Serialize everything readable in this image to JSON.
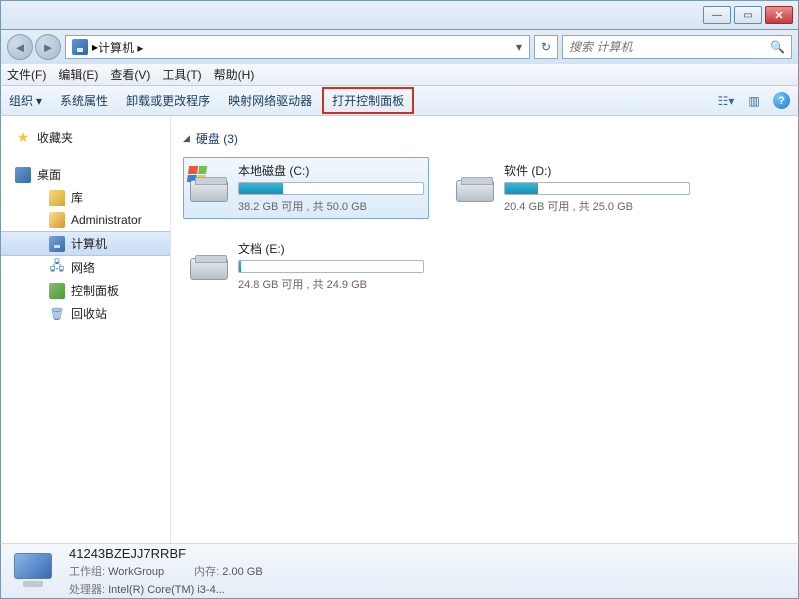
{
  "titlebar": {
    "min": "—",
    "max": "▭",
    "close": "✕"
  },
  "address": {
    "path_prefix": "▸",
    "path": "计算机 ▸",
    "dropdown": "▾",
    "refresh": "↻",
    "search_placeholder": "搜索 计算机",
    "search_icon": "🔍"
  },
  "menus": {
    "file": "文件(F)",
    "edit": "编辑(E)",
    "view": "查看(V)",
    "tools": "工具(T)",
    "help": "帮助(H)"
  },
  "toolbar": {
    "organize": "组织",
    "sys_props": "系统属性",
    "uninstall": "卸载或更改程序",
    "map_drive": "映射网络驱动器",
    "open_ctrl": "打开控制面板",
    "view_drop": "▾",
    "help": "?"
  },
  "sidebar": {
    "favorites": "收藏夹",
    "desktop": "桌面",
    "libraries": "库",
    "admin": "Administrator",
    "computer": "计算机",
    "network": "网络",
    "control_panel": "控制面板",
    "recycle": "回收站"
  },
  "section": {
    "hdd_label": "硬盘 (3)"
  },
  "drives": [
    {
      "name": "本地磁盘 (C:)",
      "stats": "38.2 GB 可用 , 共 50.0 GB",
      "fill_pct": 24,
      "flag": true
    },
    {
      "name": "软件 (D:)",
      "stats": "20.4 GB 可用 , 共 25.0 GB",
      "fill_pct": 18,
      "flag": false
    },
    {
      "name": "文档 (E:)",
      "stats": "24.8 GB 可用 , 共 24.9 GB",
      "fill_pct": 1,
      "flag": false
    }
  ],
  "details": {
    "name": "41243BZEJJ7RRBF",
    "workgroup_lbl": "工作组:",
    "workgroup": "WorkGroup",
    "mem_lbl": "内存:",
    "mem": "2.00 GB",
    "cpu_lbl": "处理器:",
    "cpu": "Intel(R) Core(TM) i3-4..."
  }
}
